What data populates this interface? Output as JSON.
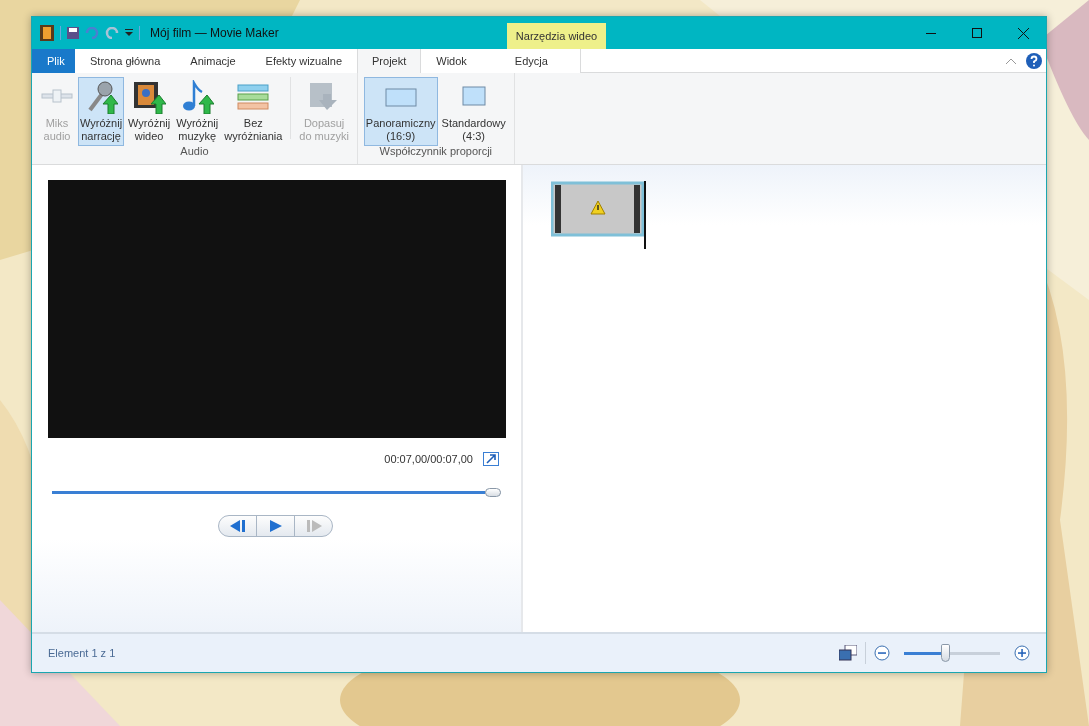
{
  "window": {
    "title": "Mój film — Movie Maker",
    "contextual_group": "Narzędzia wideo"
  },
  "tabs": [
    {
      "label": "Plik",
      "kind": "file",
      "selected": false
    },
    {
      "label": "Strona główna",
      "kind": "normal",
      "selected": false
    },
    {
      "label": "Animacje",
      "kind": "normal",
      "selected": false
    },
    {
      "label": "Efekty wizualne",
      "kind": "normal",
      "selected": false
    },
    {
      "label": "Projekt",
      "kind": "normal",
      "selected": true
    },
    {
      "label": "Widok",
      "kind": "normal",
      "selected": false
    },
    {
      "label": "Edycja",
      "kind": "contextual",
      "selected": false
    }
  ],
  "ribbon": {
    "groups": [
      {
        "label": "Audio",
        "sections": [
          [
            {
              "lines": [
                "Miks",
                "audio"
              ],
              "kind": "mixer",
              "disabled": true,
              "selected": false
            },
            {
              "lines": [
                "Wyróżnij",
                "narrację"
              ],
              "kind": "microphone",
              "disabled": false,
              "selected": true
            },
            {
              "lines": [
                "Wyróżnij",
                "wideo"
              ],
              "kind": "film",
              "disabled": false,
              "selected": false
            },
            {
              "lines": [
                "Wyróżnij",
                "muzykę"
              ],
              "kind": "note",
              "disabled": false,
              "selected": false
            },
            {
              "lines": [
                "Bez",
                "wyróżniania"
              ],
              "kind": "lines",
              "disabled": false,
              "selected": false
            }
          ],
          [
            {
              "lines": [
                "Dopasuj",
                "do muzyki"
              ],
              "kind": "fit",
              "disabled": true,
              "selected": false
            }
          ]
        ]
      },
      {
        "label": "Współczynnik proporcji",
        "sections": [
          [
            {
              "lines": [
                "Panoramiczny",
                "(16:9)"
              ],
              "kind": "wide",
              "disabled": false,
              "selected": true
            },
            {
              "lines": [
                "Standardowy",
                "(4:3)"
              ],
              "kind": "standard",
              "disabled": false,
              "selected": false
            }
          ]
        ]
      }
    ]
  },
  "preview": {
    "time": "00:07,00/00:07,00",
    "level": 1,
    "controls": [
      {
        "kind": "previous",
        "disabled": false
      },
      {
        "kind": "play",
        "disabled": false
      },
      {
        "kind": "next",
        "disabled": true
      }
    ]
  },
  "status_bar": {
    "text": "Element 1 z 1",
    "level": 0.43
  }
}
